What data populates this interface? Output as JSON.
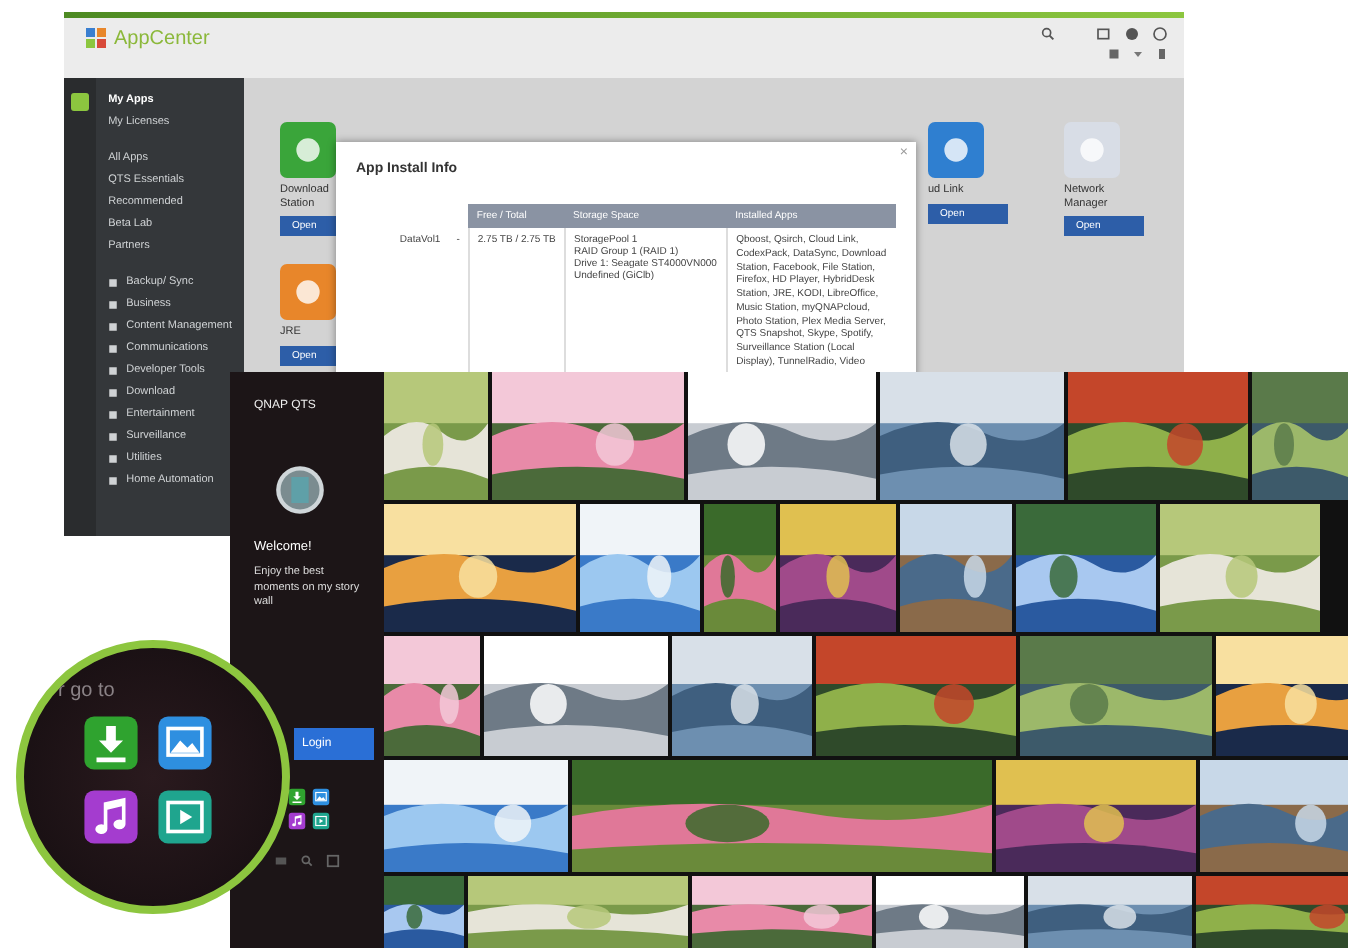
{
  "appcenter": {
    "title": "AppCenter",
    "sidebar": {
      "items": [
        {
          "label": "My Apps",
          "selected": true
        },
        {
          "label": "My Licenses",
          "selected": false
        },
        {
          "label": "All Apps",
          "selected": false
        },
        {
          "label": "QTS Essentials",
          "selected": false
        },
        {
          "label": "Recommended",
          "selected": false
        },
        {
          "label": "Beta Lab",
          "selected": false
        },
        {
          "label": "Partners",
          "selected": false
        }
      ],
      "categories": [
        {
          "label": "Backup/ Sync"
        },
        {
          "label": "Business"
        },
        {
          "label": "Content Management"
        },
        {
          "label": "Communications"
        },
        {
          "label": "Developer Tools"
        },
        {
          "label": "Download"
        },
        {
          "label": "Entertainment"
        },
        {
          "label": "Surveillance"
        },
        {
          "label": "Utilities"
        },
        {
          "label": "Home Automation"
        }
      ]
    },
    "apps_left": [
      {
        "name": "Download Station",
        "color": "#3aa53a",
        "button": "Open"
      },
      {
        "name": "JRE",
        "color": "#e8862a",
        "button": "Open"
      }
    ],
    "apps_right": [
      {
        "name": "ud Link",
        "color": "#2f7fd0",
        "button": "Open"
      },
      {
        "name": "Network Manager",
        "color": "#d8dde6",
        "button": "Open"
      }
    ],
    "dialog": {
      "title": "App Install Info",
      "close": "×",
      "columns": [
        "Free / Total",
        "Storage Space",
        "Installed Apps"
      ],
      "row": {
        "volume": "DataVol1",
        "separator": "-",
        "free": "2.75 TB / 2.75 TB",
        "storage": [
          "StoragePool 1",
          "RAID Group 1 (RAID 1)",
          "Drive 1: Seagate ST4000VN000",
          "Undefined (GiClb)"
        ],
        "apps": "Qboost, Qsirch, Cloud Link, CodexPack, DataSync, Download Station, Facebook, File Station, Firefox, HD Player, HybridDesk Station, JRE, KODI, LibreOffice, Music Station, myQNAPcloud, Photo Station, Plex Media Server, QTS Snapshot, Skype, Spotify, Surveillance Station (Local Display), TunnelRadio, Video"
      }
    }
  },
  "photo": {
    "brand": "QNAP QTS",
    "welcome": "Welcome!",
    "message": "Enjoy the best moments on my story wall",
    "login": "Login"
  },
  "magnifier": {
    "caption": "r go to"
  }
}
